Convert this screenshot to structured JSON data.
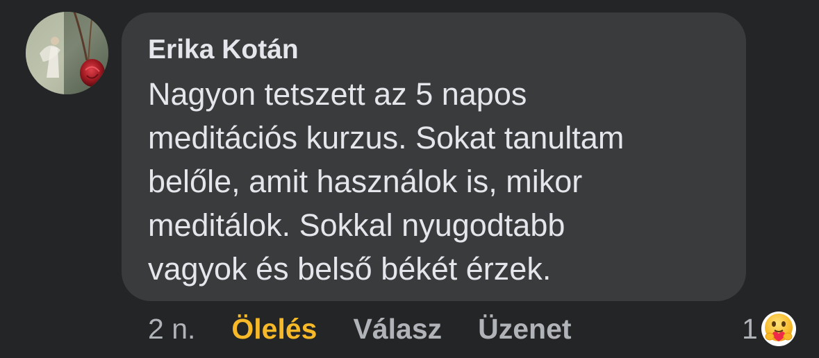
{
  "comment": {
    "author": "Erika Kotán",
    "text": "Nagyon tetszett az 5 napos\nmeditációs kurzus. Sokat tanultam\nbelőle, amit használok is, mikor\nmeditálok. Sokkal nyugodtabb\nvagyok és belső békét érzek.",
    "timestamp": "2 n.",
    "actions": {
      "reaction_label": "Ölelés",
      "reply_label": "Válasz",
      "message_label": "Üzenet"
    },
    "reactions": {
      "count": "1",
      "icon": "care-hug-emoji"
    }
  },
  "colors": {
    "background": "#242526",
    "bubble": "#3a3b3c",
    "text": "#e4e6eb",
    "secondary_text": "#b0b3b8",
    "active_reaction": "#f7b928"
  }
}
